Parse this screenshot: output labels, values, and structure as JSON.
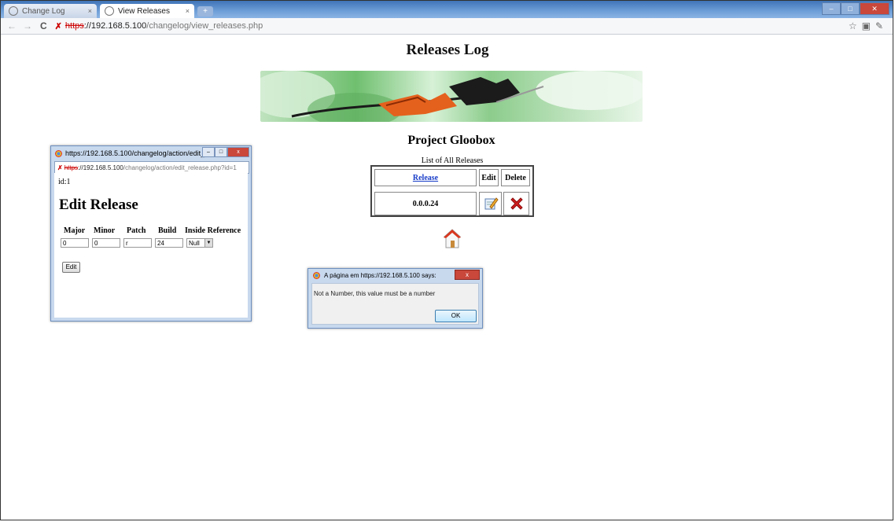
{
  "browser": {
    "tabs": [
      {
        "label": "Change Log",
        "active": false
      },
      {
        "label": "View Releases",
        "active": true
      }
    ],
    "url": {
      "protocol": "https",
      "rest_host": "://192.168.5.100",
      "path": "/changelog/view_releases.php"
    }
  },
  "page": {
    "title": "Releases Log",
    "project_title": "Project Gloobox",
    "list_caption": "List of All Releases",
    "table": {
      "headers": {
        "release": "Release",
        "edit": "Edit",
        "delete": "Delete"
      },
      "rows": [
        {
          "release": "0.0.0.24"
        }
      ]
    }
  },
  "popup": {
    "window_title": "https://192.168.5.100/changelog/action/edit_relea...",
    "url": {
      "protocol": "https",
      "rest_host": "://192.168.5.100",
      "path": "/changelog/action/edit_release.php?id=1"
    },
    "id_line": "id:1",
    "heading": "Edit Release",
    "fields": {
      "major": {
        "label": "Major",
        "value": "0"
      },
      "minor": {
        "label": "Minor",
        "value": "0"
      },
      "patch": {
        "label": "Patch",
        "value": "r"
      },
      "build": {
        "label": "Build",
        "value": "24"
      },
      "inside_reference": {
        "label": "Inside Reference",
        "value": "Null"
      }
    },
    "edit_button": "Edit"
  },
  "alert": {
    "title": "A página em https://192.168.5.100 says:",
    "message": "Not a Number, this value must be a number",
    "ok_label": "OK"
  },
  "colors": {
    "tabbar": "#6f9fd8",
    "link": "#1a3ec9",
    "close_red": "#c9473b",
    "delete_x": "#d11f1f"
  }
}
